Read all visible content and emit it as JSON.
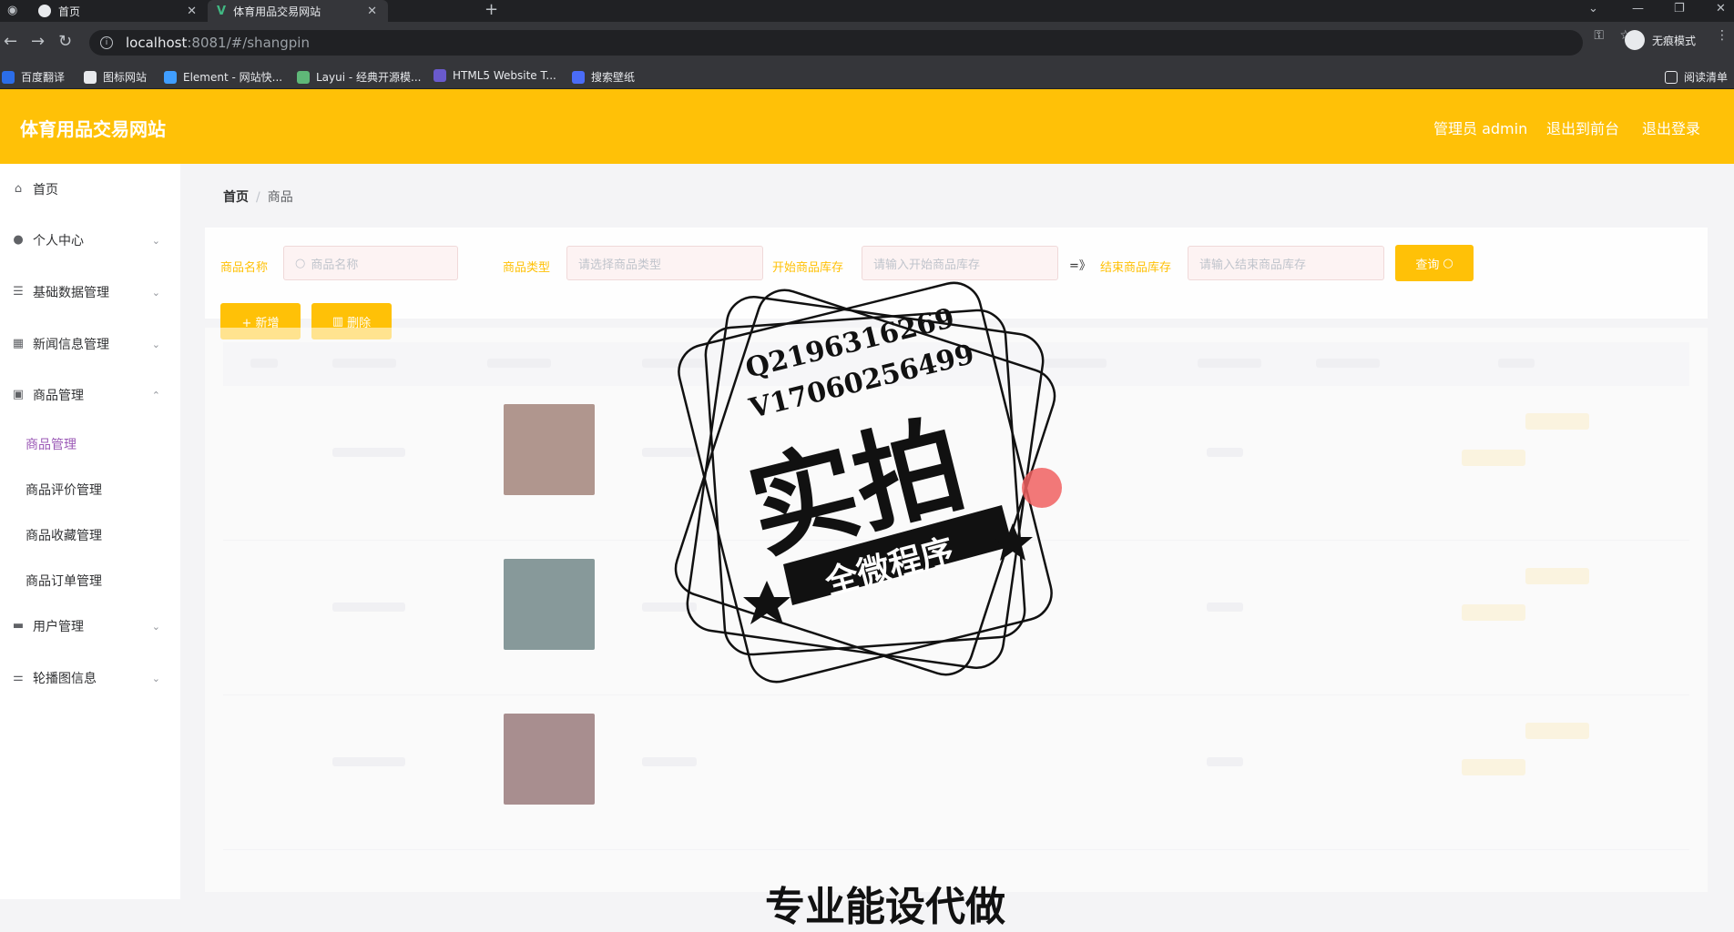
{
  "browser": {
    "tabs": [
      {
        "label": "首页"
      },
      {
        "label": "体育用品交易网站"
      }
    ],
    "url_host": "localhost",
    "url_path": ":8081/#/shangpin",
    "incognito_label": "无痕模式",
    "bookmarks": [
      {
        "label": "百度翻译"
      },
      {
        "label": "图标网站"
      },
      {
        "label": "Element - 网站快..."
      },
      {
        "label": "Layui - 经典开源模..."
      },
      {
        "label": "HTML5 Website T..."
      },
      {
        "label": "搜索壁纸"
      }
    ],
    "reading_list": "阅读清单"
  },
  "header": {
    "brand": "体育用品交易网站",
    "user_label": "管理员 admin",
    "to_front": "退出到前台",
    "logout": "退出登录"
  },
  "sidebar": {
    "items": [
      {
        "label": "首页",
        "icon": "home-icon"
      },
      {
        "label": "个人中心",
        "icon": "user-icon"
      },
      {
        "label": "基础数据管理",
        "icon": "menu-icon"
      },
      {
        "label": "新闻信息管理",
        "icon": "grid-icon"
      },
      {
        "label": "商品管理",
        "icon": "goods-icon"
      },
      {
        "label": "用户管理",
        "icon": "monitor-icon"
      },
      {
        "label": "轮播图信息",
        "icon": "sliders-icon"
      }
    ],
    "sub_items": [
      {
        "label": "商品管理"
      },
      {
        "label": "商品评价管理"
      },
      {
        "label": "商品收藏管理"
      },
      {
        "label": "商品订单管理"
      }
    ]
  },
  "breadcrumb": {
    "home": "首页",
    "separator": "/",
    "current": "商品"
  },
  "filters": {
    "name_label": "商品名称",
    "name_placeholder": "商品名称",
    "type_label": "商品类型",
    "type_placeholder": "请选择商品类型",
    "stock_start_label": "开始商品库存",
    "stock_start_placeholder": "请输入开始商品库存",
    "range_sep": "=》",
    "stock_end_label": "结束商品库存",
    "stock_end_placeholder": "请输入结束商品库存",
    "search_label": "查询"
  },
  "actions": {
    "add_label": "+ 新增",
    "delete_label": "删除"
  },
  "watermark": {
    "qq": "Q2196316269",
    "vx": "V17060256499",
    "main": "实拍",
    "banner": "全微程序"
  },
  "footer_text": "专业能设代做",
  "colors": {
    "header": "#ffc107",
    "active_submenu": "#9b59b6"
  }
}
